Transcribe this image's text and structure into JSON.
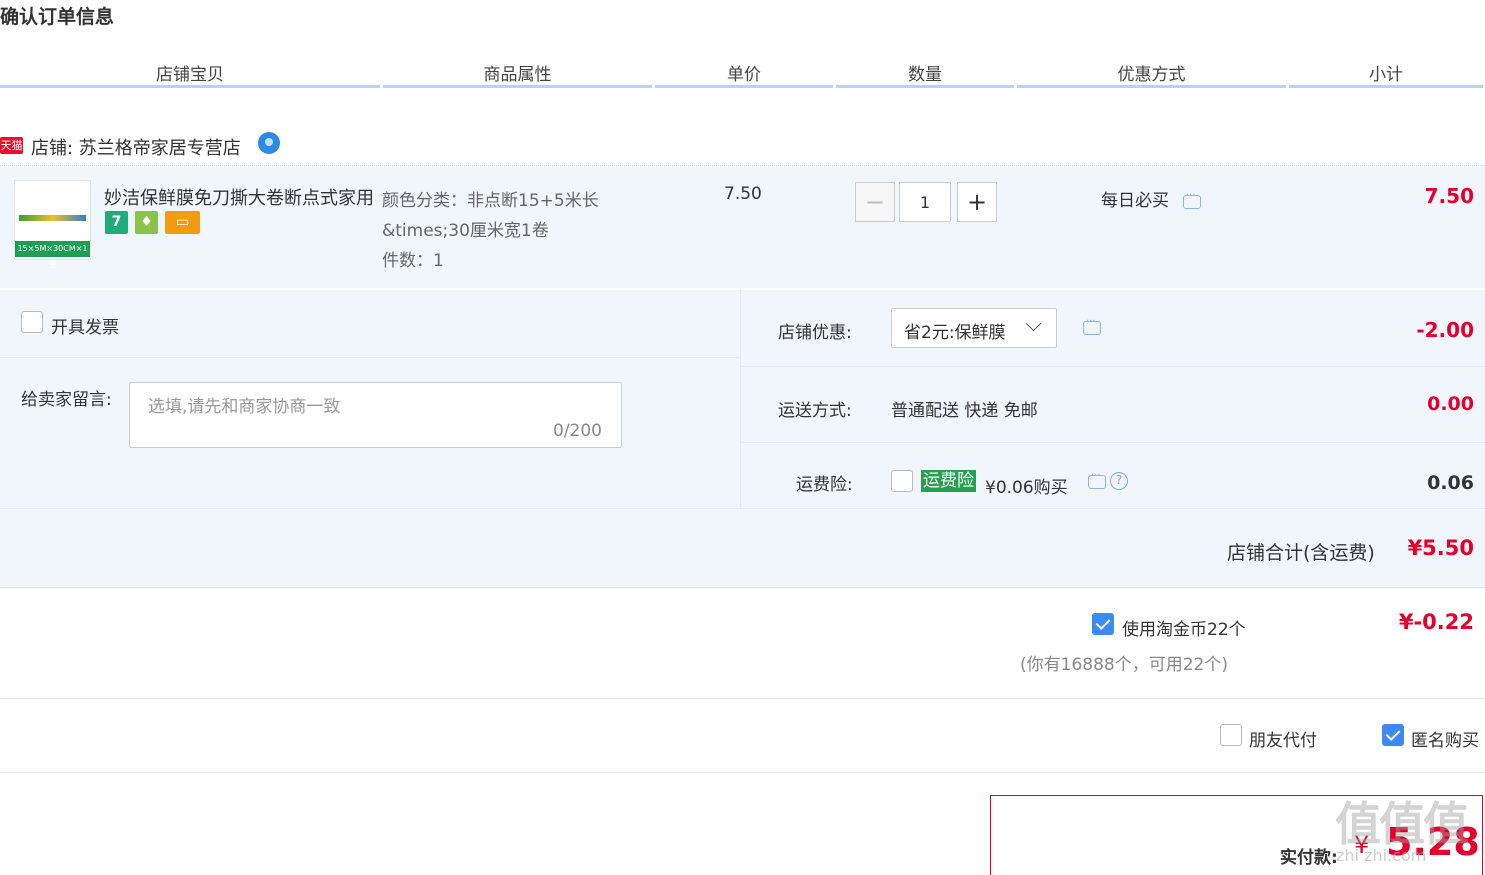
{
  "page_title": "确认订单信息",
  "columns": [
    "店铺宝贝",
    "商品属性",
    "单价",
    "数量",
    "优惠方式",
    "小计"
  ],
  "store": {
    "badge": "天猫",
    "label": "店铺: 苏兰格帝家居专营店"
  },
  "item": {
    "thumb_text": "15×5M×30CM×1卷",
    "badges": [
      {
        "text": "7",
        "color": "#1fae7a"
      },
      {
        "text": "♦",
        "color": "#8bc34a"
      },
      {
        "text": "▭",
        "color": "#f39c12"
      }
    ],
    "name": "妙洁保鲜膜免刀撕大卷断点式家用经济装",
    "sku_color": "颜色分类：非点断15+5米长&times;30厘米宽1卷",
    "sku_count": "件数：1",
    "unit_price": "7.50",
    "qty_minus": "−",
    "qty": "1",
    "qty_plus": "+",
    "promo": "每日必买",
    "subtotal": "7.50"
  },
  "options": {
    "invoice_label": "开具发票",
    "message_label": "给卖家留言:",
    "message_placeholder": "选填,请先和商家协商一致",
    "message_count": "0/200",
    "shop_discount_label": "店铺优惠:",
    "shop_discount_value": "省2元:保鲜膜",
    "shop_discount_amount": "-2.00",
    "shipping_label": "运送方式:",
    "shipping_value": "普通配送 快递 免邮",
    "shipping_amount": "0.00",
    "insurance_label": "运费险:",
    "insurance_tag": "运费险",
    "insurance_text": "¥0.06购买",
    "insurance_help": "?",
    "insurance_amount": "0.06"
  },
  "shop_total": {
    "label": "店铺合计(含运费)",
    "value": "¥5.50"
  },
  "coins": {
    "label": "使用淘金币22个",
    "sub": "(你有16888个，可用22个)",
    "value": "¥-0.22"
  },
  "extras": {
    "friend_pay": "朋友代付",
    "anonymous": "匿名购买"
  },
  "payment": {
    "label": "实付款:",
    "symbol": "¥",
    "value": "5.28"
  },
  "watermark": {
    "main": "值值值",
    "sub": "zhi zhi.com"
  }
}
